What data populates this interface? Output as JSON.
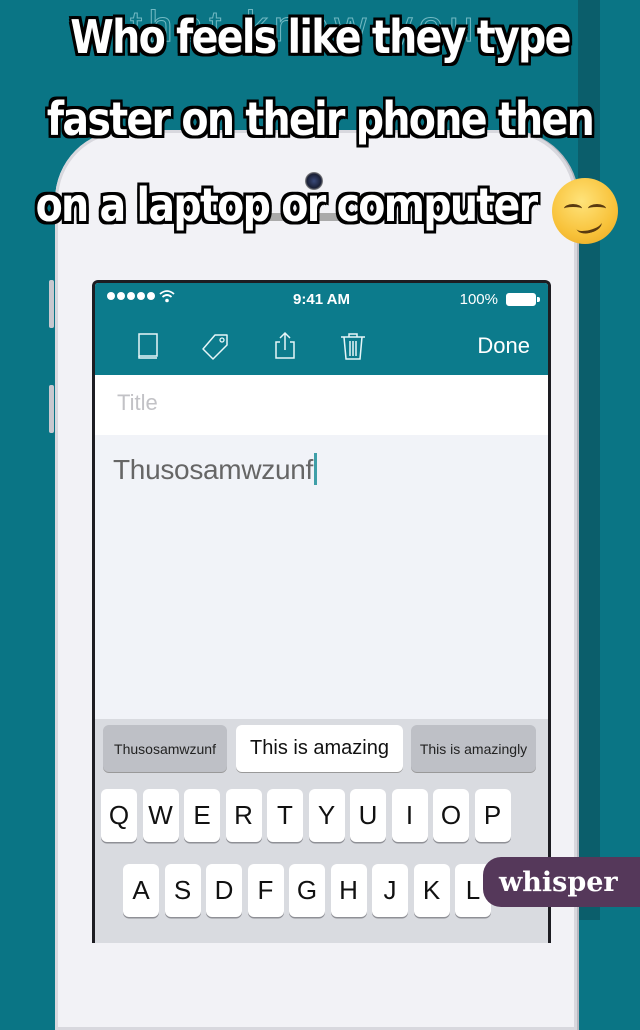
{
  "meme": {
    "headline_lines": [
      "Who feels like they type",
      "faster on their phone then",
      "on a laptop or computer"
    ],
    "emoji": "smirking-face",
    "background_text": "that know you",
    "watermark": "whisper"
  },
  "phone": {
    "status_bar": {
      "signal_dots": 5,
      "wifi_icon": "wifi-icon",
      "time": "9:41 AM",
      "battery_label": "100%",
      "battery_level": 1.0
    },
    "toolbar": {
      "icons": [
        "book-icon",
        "tag-icon",
        "share-icon",
        "trash-icon"
      ],
      "done_label": "Done"
    },
    "note": {
      "title_placeholder": "Title",
      "title_value": "",
      "body_text": "Thusosamwzunf"
    },
    "suggestions": [
      "Thusosamwzunf",
      "This is amazing",
      "This is amazingly"
    ],
    "keyboard": {
      "row1": [
        "Q",
        "W",
        "E",
        "R",
        "T",
        "Y",
        "U",
        "I",
        "O",
        "P"
      ],
      "row2": [
        "A",
        "S",
        "D",
        "F",
        "G",
        "H",
        "J",
        "K",
        "L"
      ]
    }
  },
  "colors": {
    "background": "#0a7585",
    "app_bar": "#0c7b8c",
    "watermark_bg": "#55385a",
    "caret": "#3f9fa8"
  }
}
